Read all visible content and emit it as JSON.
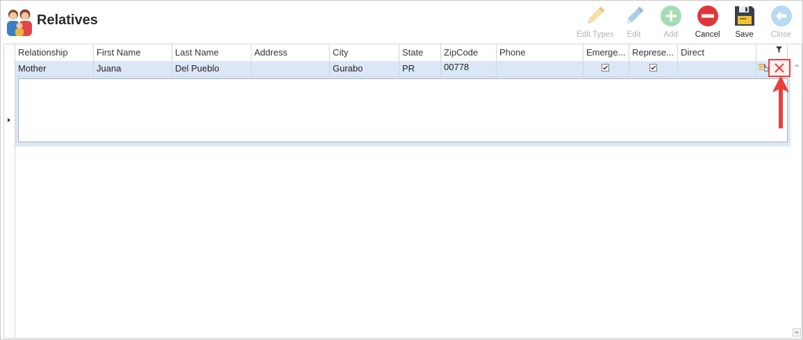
{
  "window": {
    "title": "Relatives"
  },
  "toolbar": {
    "buttons": [
      {
        "label": "Edit Types",
        "icon": "pencil-icon",
        "enabled": false
      },
      {
        "label": "Edit",
        "icon": "pencil-blue-icon",
        "enabled": false
      },
      {
        "label": "Add",
        "icon": "plus-circle-icon",
        "enabled": false
      },
      {
        "label": "Cancel",
        "icon": "minus-circle-icon",
        "enabled": true
      },
      {
        "label": "Save",
        "icon": "floppy-disk-icon",
        "enabled": true
      },
      {
        "label": "Close",
        "icon": "arrow-left-circle-icon",
        "enabled": false
      }
    ]
  },
  "grid": {
    "columns": [
      "Relationship",
      "First Name",
      "Last Name",
      "Address",
      "City",
      "State",
      "ZipCode",
      "Phone",
      "Emerge...",
      "Represe...",
      "Direct"
    ],
    "rows": [
      {
        "relationship": "Mother",
        "first_name": "Juana",
        "last_name": "Del Pueblo",
        "address": "",
        "city": "Gurabo",
        "state": "PR",
        "zipcode": "00778",
        "phone": "",
        "emergency": true,
        "representative": true,
        "direct": ""
      }
    ]
  },
  "colors": {
    "accent": "#e8413c",
    "row_selected": "#dbe7f6",
    "cancel_red": "#e0363b",
    "save_dark": "#3a3f4b"
  }
}
